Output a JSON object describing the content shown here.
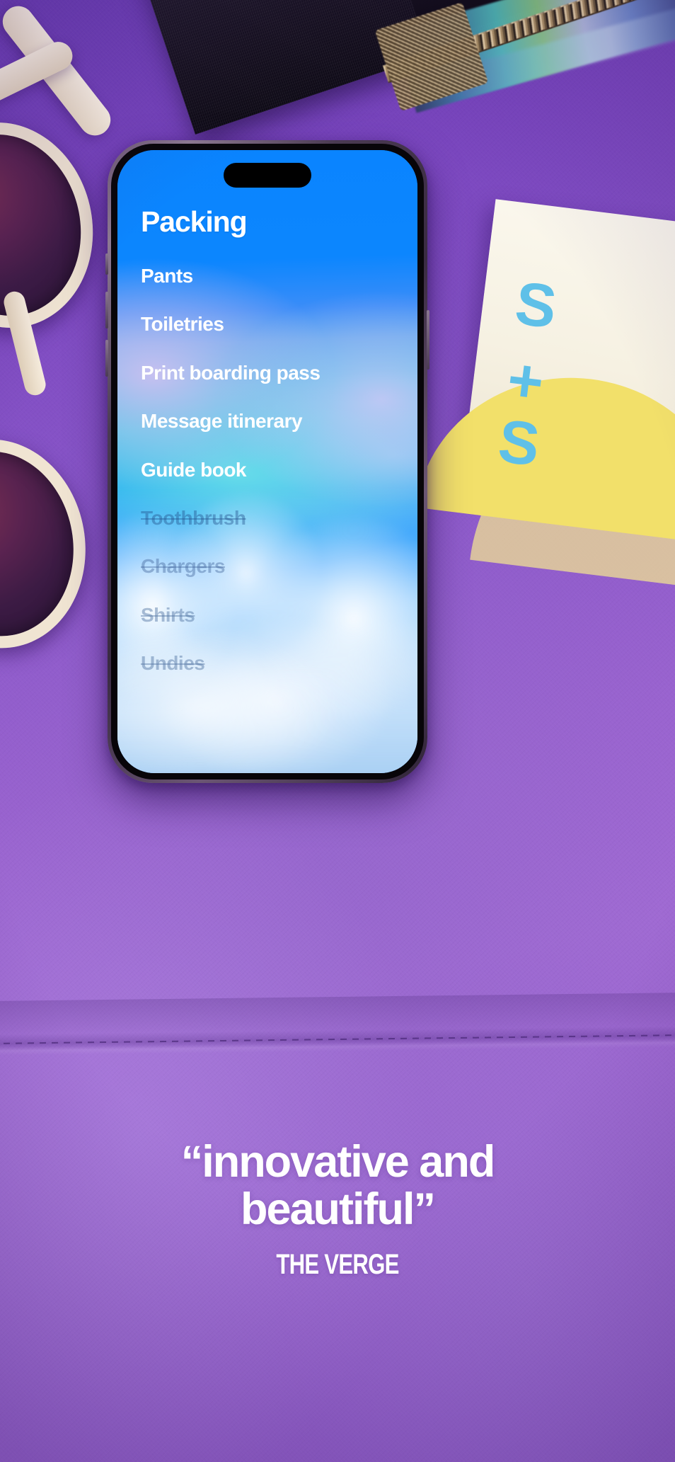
{
  "app": {
    "list_title": "Packing",
    "items": [
      {
        "label": "Pants",
        "done": false
      },
      {
        "label": "Toiletries",
        "done": false
      },
      {
        "label": "Print boarding pass",
        "done": false
      },
      {
        "label": "Message itinerary",
        "done": false
      },
      {
        "label": "Guide book",
        "done": false
      },
      {
        "label": "Toothbrush",
        "done": true
      },
      {
        "label": "Chargers",
        "done": true
      },
      {
        "label": "Shirts",
        "done": true
      },
      {
        "label": "Undies",
        "done": true
      }
    ]
  },
  "testimonial": {
    "quote_line_1": "“innovative and",
    "quote_line_2": "beautiful”",
    "source": "THE VERGE"
  },
  "scene": {
    "card_letter_1": "S",
    "card_letter_2": "+",
    "card_letter_3": "S"
  },
  "colors": {
    "background_purple": "#8a57c9",
    "screen_blue": "#0a84ff",
    "screen_cyan": "#2ec3e6",
    "screen_lavender": "#cdc0f0",
    "text_white": "#ffffff",
    "done_item": "#3c6096",
    "card_cyan": "#5fc0e8",
    "card_yellow": "#f2e06a",
    "card_cream": "#fbf8ee",
    "phone_frame": "#6b5673"
  }
}
